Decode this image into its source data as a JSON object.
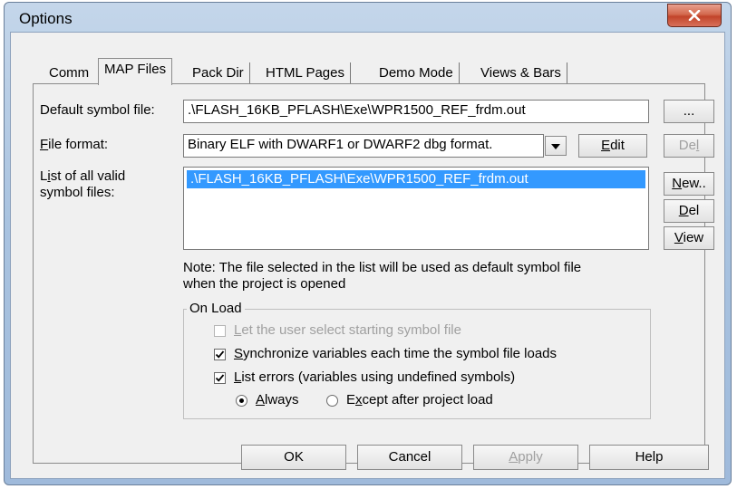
{
  "window": {
    "title": "Options"
  },
  "tabs": [
    {
      "label": "Comm",
      "selected": false
    },
    {
      "label": "MAP Files",
      "selected": true
    },
    {
      "label": "Pack Dir",
      "selected": false
    },
    {
      "label": "HTML Pages",
      "selected": false
    },
    {
      "label": "Demo Mode",
      "selected": false
    },
    {
      "label": "Views & Bars",
      "selected": false
    }
  ],
  "map_files": {
    "default_symbol_label": "Default symbol file:",
    "default_symbol_value": ".\\FLASH_16KB_PFLASH\\Exe\\WPR1500_REF_frdm.out",
    "browse_label": "...",
    "file_format_label_accel": "F",
    "file_format_label_rest": "ile format:",
    "file_format_value": "Binary ELF with DWARF1 or DWARF2 dbg format.",
    "edit_accel": "E",
    "edit_rest": "dit",
    "del_top_pre": "De",
    "del_top_accel": "l",
    "list_label_pre": "L",
    "list_label_accel": "i",
    "list_label_rest1": "st of all valid",
    "list_label_line2": "symbol files:",
    "list_items": [
      ".\\FLASH_16KB_PFLASH\\Exe\\WPR1500_REF_frdm.out"
    ],
    "new_accel": "N",
    "new_rest": "ew..",
    "del_accel": "D",
    "del_rest": "el",
    "view_accel": "V",
    "view_rest": "iew",
    "note_line1": "Note: The file selected in the list will be used as default symbol file",
    "note_line2": "when the project is opened"
  },
  "on_load": {
    "title": "On Load",
    "let_user_accel": "L",
    "let_user_rest": "et the user select starting symbol file",
    "let_user_checked": false,
    "let_user_enabled": false,
    "sync_accel": "S",
    "sync_rest": "ynchronize variables each time the symbol file loads",
    "sync_checked": true,
    "list_errors_accel": "L",
    "list_errors_rest": "ist errors (variables using undefined symbols)",
    "list_errors_checked": true,
    "always_accel": "A",
    "always_rest": "lways",
    "always_selected": true,
    "except_pre": "E",
    "except_accel": "x",
    "except_rest": "cept after project load",
    "except_selected": false
  },
  "buttons": {
    "ok": "OK",
    "cancel": "Cancel",
    "apply_accel": "A",
    "apply_rest": "pply",
    "help": "Help"
  },
  "colors": {
    "selection": "#3399ff",
    "close_button": "#c2442a",
    "frame": "#a9c3e0"
  }
}
